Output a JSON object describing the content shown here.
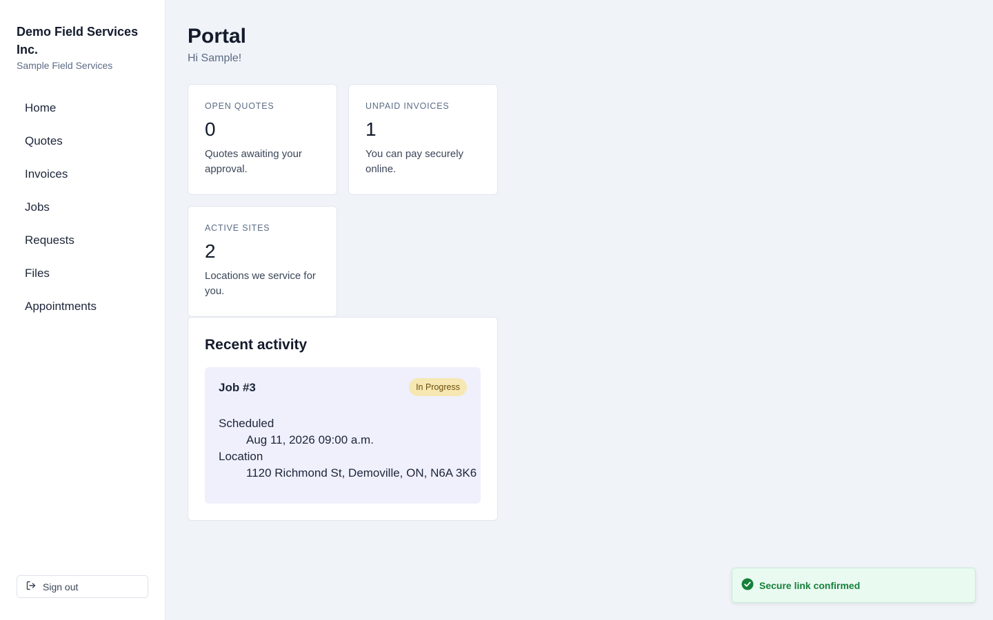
{
  "brand": {
    "name": "Demo Field Services Inc.",
    "subtitle": "Sample Field Services"
  },
  "nav": {
    "items": [
      {
        "label": "Home"
      },
      {
        "label": "Quotes"
      },
      {
        "label": "Invoices"
      },
      {
        "label": "Jobs"
      },
      {
        "label": "Requests"
      },
      {
        "label": "Files"
      },
      {
        "label": "Appointments"
      }
    ],
    "signout_label": "Sign out"
  },
  "header": {
    "title": "Portal",
    "greeting": "Hi Sample!"
  },
  "stats": [
    {
      "label": "OPEN QUOTES",
      "value": "0",
      "description": "Quotes awaiting your approval."
    },
    {
      "label": "UNPAID INVOICES",
      "value": "1",
      "description": "You can pay securely online."
    },
    {
      "label": "ACTIVE SITES",
      "value": "2",
      "description": "Locations we service for you."
    }
  ],
  "activity": {
    "title": "Recent activity",
    "items": [
      {
        "title": "Job #3",
        "status": "In Progress",
        "status_color": "#f6e7b3",
        "scheduled_label": "Scheduled",
        "scheduled_value": "Aug 11, 2026 09:00 a.m.",
        "location_label": "Location",
        "location_value": "1120 Richmond St, Demoville, ON, N6A 3K6"
      }
    ]
  },
  "toast": {
    "message": "Secure link confirmed",
    "icon": "check-circle-icon",
    "color": "#16803a"
  }
}
